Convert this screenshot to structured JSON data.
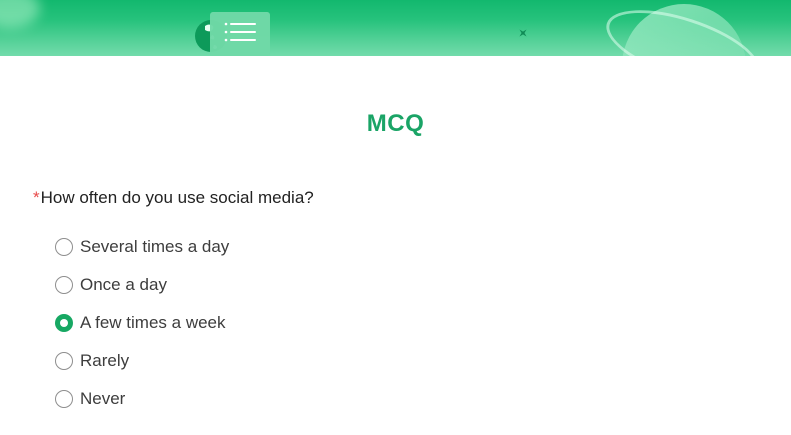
{
  "banner": {
    "illustration_icon": "globe-list-icon",
    "sparkle_icon": "sparkle-icon",
    "decoration": "planet-icon"
  },
  "form": {
    "title": "MCQ"
  },
  "question": {
    "required_marker": "*",
    "text": "How often do you use social media?",
    "selected_index": 2,
    "options": [
      {
        "label": "Several times a day",
        "checked": false
      },
      {
        "label": "Once a day",
        "checked": false
      },
      {
        "label": "A few times a week",
        "checked": true
      },
      {
        "label": "Rarely",
        "checked": false
      },
      {
        "label": "Never",
        "checked": false
      }
    ]
  },
  "colors": {
    "accent": "#17a863",
    "banner_green": "#26c27c",
    "required": "#e84a4a"
  }
}
